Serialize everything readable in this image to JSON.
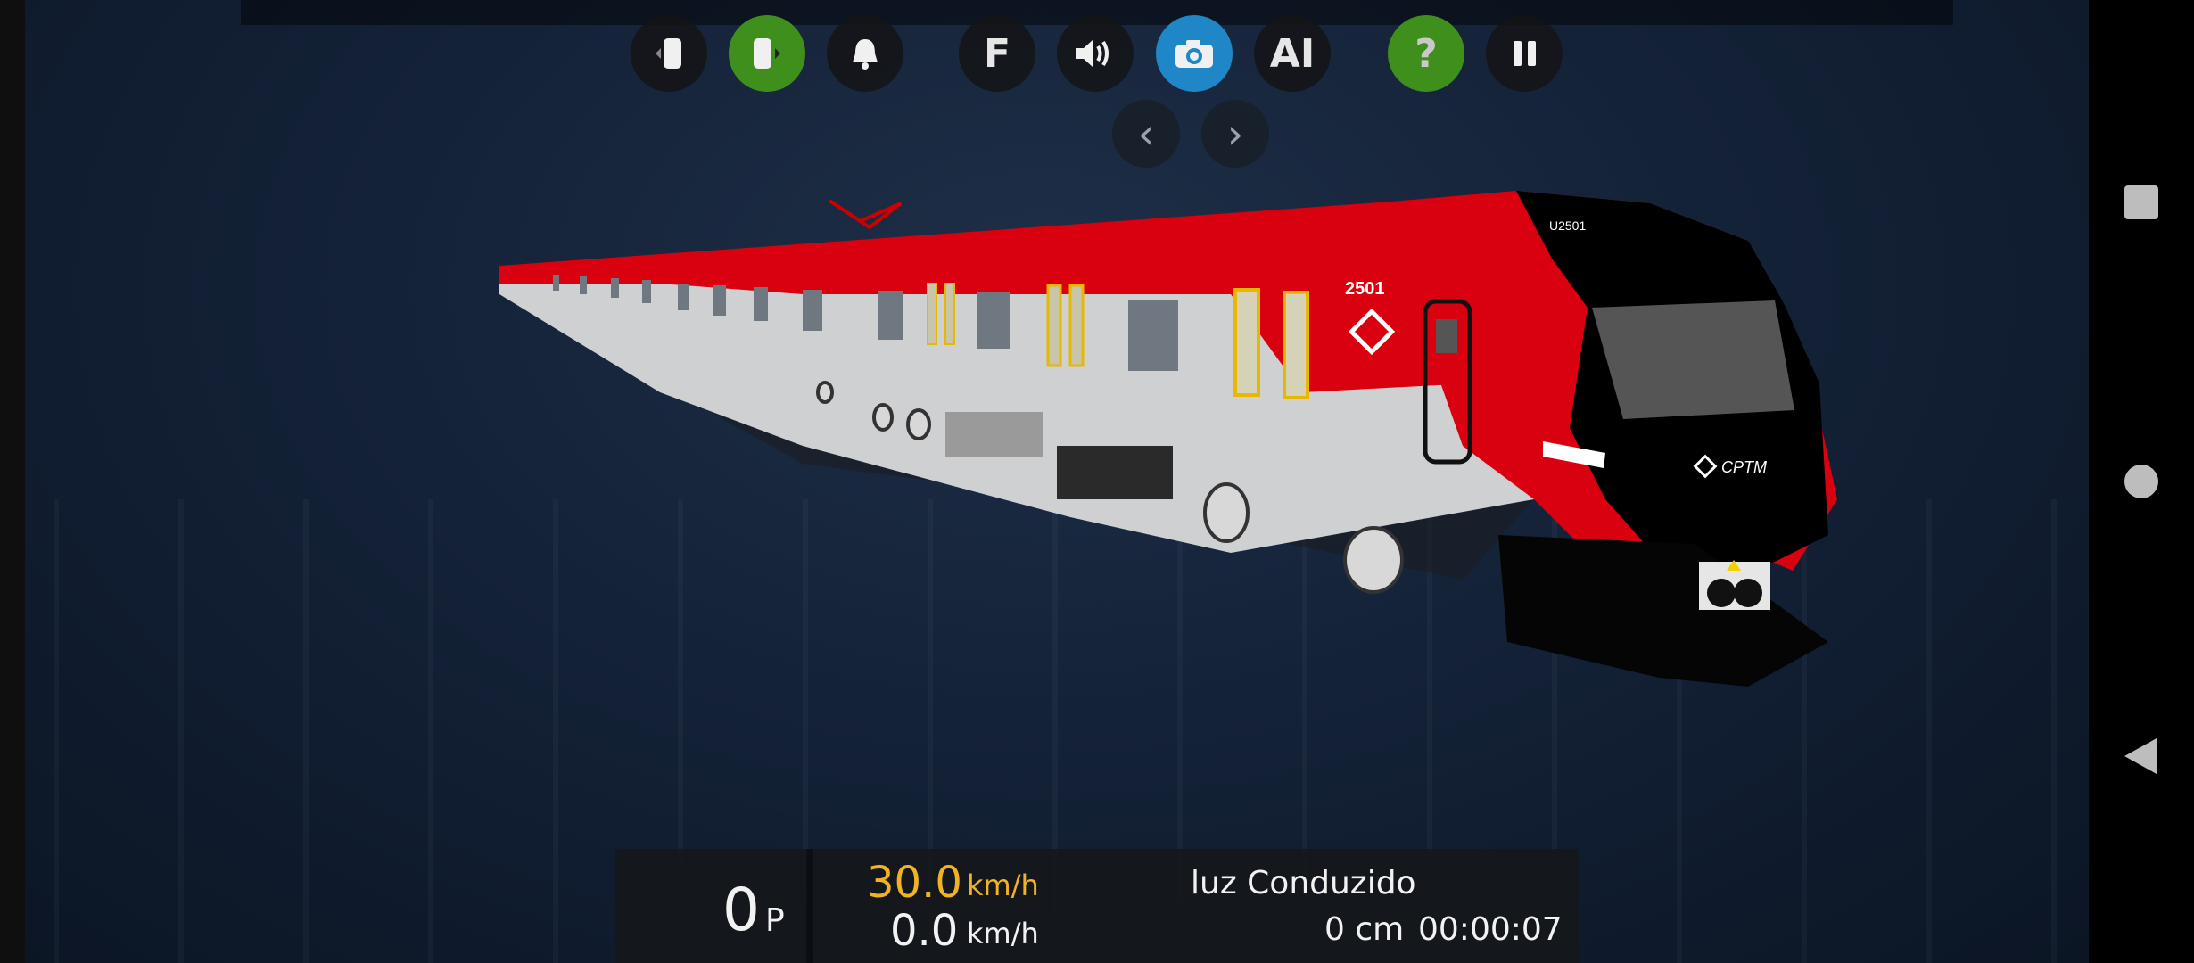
{
  "toolbar": {
    "buttons": [
      {
        "name": "cab-left-button",
        "icon": "door-left-icon",
        "style": "dark"
      },
      {
        "name": "cab-right-button",
        "icon": "door-right-icon",
        "style": "green"
      },
      {
        "name": "bell-button",
        "icon": "bell-icon",
        "style": "dark"
      },
      {
        "name": "f-button",
        "label": "F",
        "style": "dark"
      },
      {
        "name": "sound-button",
        "icon": "speaker-icon",
        "style": "dark"
      },
      {
        "name": "camera-button",
        "icon": "camera-icon",
        "style": "blue"
      },
      {
        "name": "ai-button",
        "label": "AI",
        "style": "dark"
      },
      {
        "name": "help-button",
        "label": "?",
        "style": "green"
      },
      {
        "name": "pause-button",
        "icon": "pause-icon",
        "style": "dark"
      }
    ],
    "prev_label": "‹",
    "next_label": "›"
  },
  "train": {
    "number": "2501",
    "cab_code": "U2501",
    "logo": "CPTM"
  },
  "hud": {
    "power_value": "0",
    "power_unit": "P",
    "target_speed": "30.0",
    "target_unit": "km/h",
    "current_speed": "0.0",
    "current_unit": "km/h",
    "mode_label": "luz Conduzido",
    "distance": "0 cm",
    "timer": "00:00:07"
  },
  "colors": {
    "accent_green": "#3f8f1d",
    "accent_blue": "#1f86c7",
    "speed_yellow": "#f0b323",
    "train_red": "#d9000f"
  }
}
